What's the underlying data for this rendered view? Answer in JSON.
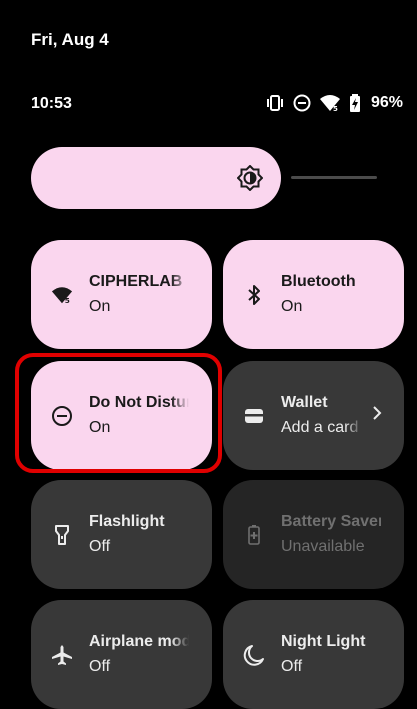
{
  "status": {
    "date": "Fri, Aug 4",
    "time": "10:53",
    "battery": "96%"
  },
  "brightness": {
    "level": 0.83
  },
  "tiles": [
    {
      "label": "CIPHERLAB",
      "sub": "On",
      "state": "on",
      "icon": "wifi-icon"
    },
    {
      "label": "Bluetooth",
      "sub": "On",
      "state": "on",
      "icon": "bluetooth-icon"
    },
    {
      "label": "Do Not Disturb",
      "sub": "On",
      "state": "on",
      "icon": "do-not-disturb-icon",
      "highlighted": true
    },
    {
      "label": "Wallet",
      "sub": "Add a card",
      "state": "off",
      "icon": "wallet-icon"
    },
    {
      "label": "Flashlight",
      "sub": "Off",
      "state": "off",
      "icon": "flashlight-icon"
    },
    {
      "label": "Battery Saver",
      "sub": "Unavailable",
      "state": "unavailable",
      "icon": "battery-saver-icon"
    },
    {
      "label": "Airplane mode",
      "sub": "Off",
      "state": "off",
      "icon": "airplane-icon"
    },
    {
      "label": "Night Light",
      "sub": "Off",
      "state": "off",
      "icon": "night-light-icon"
    }
  ],
  "colors": {
    "tile_on": "#fad6ee",
    "tile_off": "#383838",
    "tile_unavailable": "#252525",
    "highlight": "#e00000"
  }
}
